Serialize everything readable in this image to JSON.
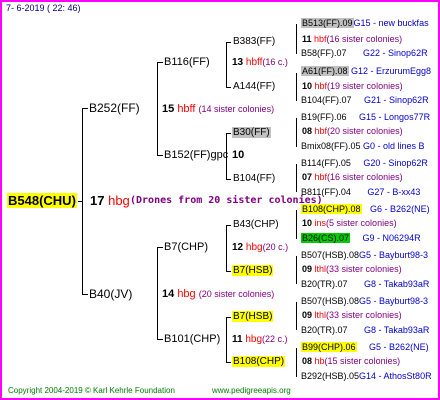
{
  "header": {
    "date": "7-  6-2019 ( 22: 46)"
  },
  "root": {
    "id": "B548(CHU)",
    "gen": "17",
    "label": "hbg",
    "note": "(Drones from 20 sister colonies)"
  },
  "gen1": {
    "upper": {
      "id": "B252(FF)",
      "gen": "15",
      "label": "hbff",
      "note": "(14 sister colonies)"
    },
    "lower": {
      "id": "B40(JV)",
      "gen": "14",
      "label": "hbg",
      "note": "(20 sister colonies)"
    }
  },
  "gen2": {
    "a": {
      "id": "B116(FF)",
      "gen": "13",
      "label": "hbff",
      "note": "(16 c.)"
    },
    "b": {
      "id": "B152(FF)gpc",
      "gen": "10"
    },
    "c": {
      "id": "B7(CHP)",
      "gen": "12",
      "label": "hbg",
      "note": "(20 c.)"
    },
    "d": {
      "id": "B101(CHP)",
      "gen": "11",
      "label": "hbg",
      "note": "(22 c.)"
    }
  },
  "gen3": {
    "a1": {
      "id": "B383(FF)",
      "gen": "11",
      "label": "hbf",
      "note": "(16 sister colonies)"
    },
    "a2": {
      "id": "A144(FF)",
      "gen": "10",
      "label": "hbf",
      "note": "(19 sister colonies)"
    },
    "b1": {
      "id": "B30(FF)",
      "gen": "08",
      "label": "hbf",
      "note": "(20 sister colonies)"
    },
    "b2": {
      "id": "B104(FF)",
      "gen": "07",
      "label": "hbf",
      "note": "(16 sister colonies)"
    },
    "c1": {
      "id": "B43(CHP)",
      "gen": "10",
      "label": "ins",
      "note": "(5 sister colonies)"
    },
    "c2": {
      "id": "B7(HSB)",
      "gen": "09",
      "label": "lthl",
      "note": "(33 sister colonies)"
    },
    "d1": {
      "id": "B7(HSB)",
      "gen": "09",
      "label": "lthl",
      "note": "(33 sister colonies)"
    },
    "d2": {
      "id": "B108(CHP)",
      "gen": "08",
      "label": "hb",
      "note": "(15 sister colonies)"
    }
  },
  "gen4": [
    {
      "id": "B513(FF).09",
      "info": "G15 - new buckfas"
    },
    {
      "id": "B58(FF).07",
      "info": "G22 - Sinop62R"
    },
    {
      "id": "A61(FF).08",
      "info": "G12 - ErzurumEgg8"
    },
    {
      "id": "B104(FF).07",
      "info": "G21 - Sinop62R"
    },
    {
      "id": "B19(FF).06",
      "info": "G15 - Longos77R"
    },
    {
      "id": "Bmix08(FF).05",
      "info": "G0 - old lines B"
    },
    {
      "id": "B114(FF).05",
      "info": "G20 - Sinop62R"
    },
    {
      "id": "B811(FF).04",
      "info": "G27 - B-xx43"
    },
    {
      "id": "B108(CHP).08",
      "info": "G6 - B262(NE)"
    },
    {
      "id": "B26(CS).07",
      "info": "G9 - N06294R"
    },
    {
      "id": "B507(HSB).08",
      "info": "G5 - Bayburt98-3"
    },
    {
      "id": "B20(TR).07",
      "info": "G8 - Takab93aR"
    },
    {
      "id": "B507(HSB).08",
      "info": "G5 - Bayburt98-3"
    },
    {
      "id": "B20(TR).07",
      "info": "G8 - Takab93aR"
    },
    {
      "id": "B99(CHP).06",
      "info": "G5 - B262(NE)"
    },
    {
      "id": "B292(HSB).05",
      "info": "G14 - AthosSt80R"
    }
  ],
  "footer": {
    "copyright": "Copyright 2004-2019 © Karl Kehrle Foundation",
    "url": "www.pedigreeapis.org"
  }
}
